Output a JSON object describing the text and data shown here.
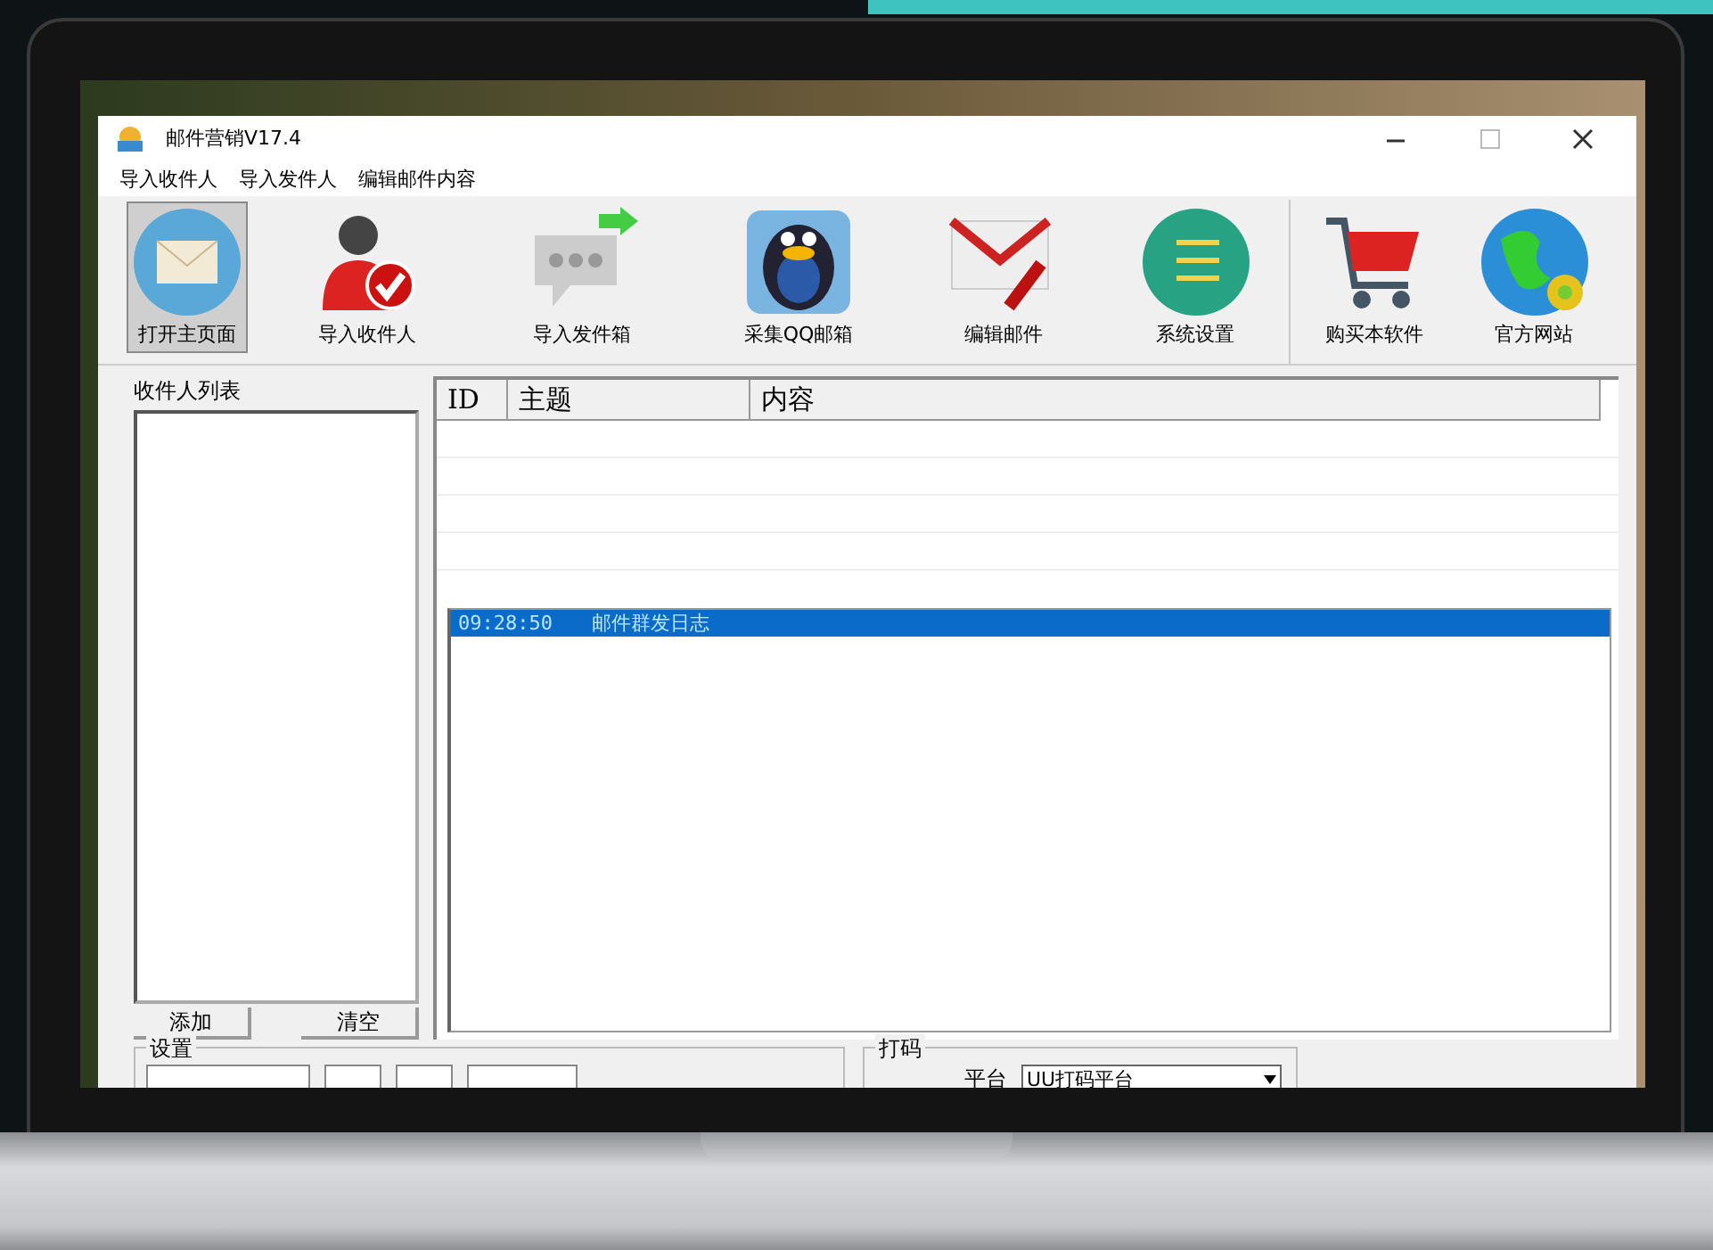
{
  "window": {
    "title": "邮件营销V17.4"
  },
  "menu": [
    "导入收件人",
    "导入发件人",
    "编辑邮件内容"
  ],
  "toolbar": [
    {
      "label": "打开主页面",
      "kind": "envelope",
      "selected": true,
      "divider_before": false
    },
    {
      "label": "导入收件人",
      "kind": "user",
      "selected": false,
      "divider_before": false
    },
    {
      "label": "导入发件箱",
      "kind": "chat",
      "selected": false,
      "divider_before": false
    },
    {
      "label": "采集QQ邮箱",
      "kind": "penguin",
      "selected": false,
      "divider_before": false
    },
    {
      "label": "编辑邮件",
      "kind": "edit",
      "selected": false,
      "divider_before": false
    },
    {
      "label": "系统设置",
      "kind": "settings",
      "selected": false,
      "divider_before": false
    },
    {
      "label": "购买本软件",
      "kind": "cart",
      "selected": false,
      "divider_before": true
    },
    {
      "label": "官方网站",
      "kind": "globe",
      "selected": false,
      "divider_before": false
    }
  ],
  "recipients": {
    "title": "收件人列表",
    "buttons": [
      "添加",
      "清空"
    ]
  },
  "table": {
    "columns": [
      "ID",
      "主题",
      "内容"
    ]
  },
  "log": [
    {
      "time": "09:28:50",
      "text": "邮件群发日志",
      "selected": true
    }
  ],
  "settings": {
    "title": "设置"
  },
  "captcha": {
    "title": "打码",
    "platform_label": "平台",
    "platform": "UU打码平台"
  }
}
